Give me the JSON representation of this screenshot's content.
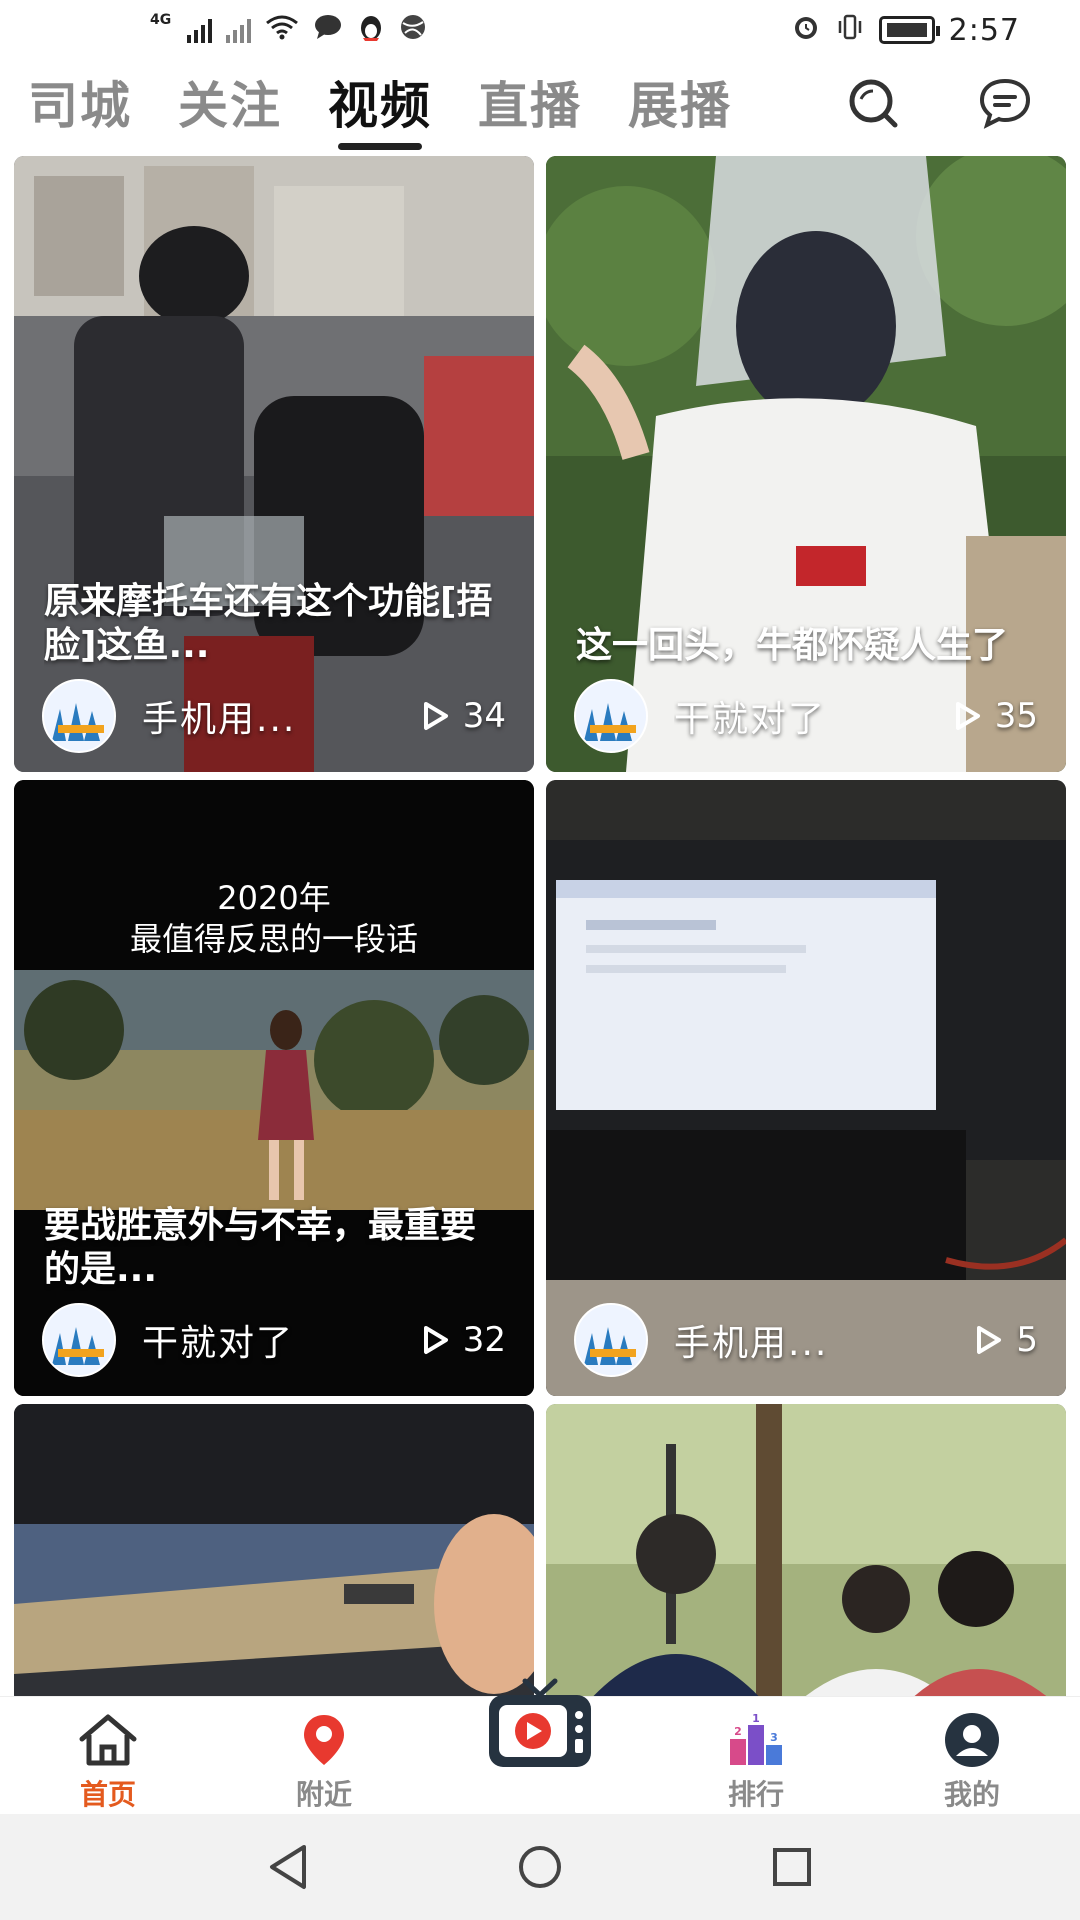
{
  "status_bar": {
    "network_label": "4G",
    "time": "2:57"
  },
  "top_nav": {
    "tabs": [
      {
        "label": "司城",
        "active": false
      },
      {
        "label": "关注",
        "active": false
      },
      {
        "label": "视频",
        "active": true
      },
      {
        "label": "直播",
        "active": false
      },
      {
        "label": "展播",
        "active": false
      }
    ],
    "icons": [
      "search-icon",
      "message-icon"
    ]
  },
  "feed": {
    "cards": [
      {
        "caption": "原来摩托车还有这个功能[捂脸]这鱼...",
        "author": "手机用...",
        "plays": "34"
      },
      {
        "caption": "这一回头，牛都怀疑人生了",
        "author": "干就对了",
        "plays": "35"
      },
      {
        "overlay": "2020年\n最值得反思的一段话",
        "caption": "要战胜意外与不幸，最重要的是...",
        "author": "干就对了",
        "plays": "32"
      },
      {
        "caption": "",
        "author": "手机用...",
        "plays": "5"
      },
      {
        "caption": "",
        "author": "",
        "plays": ""
      },
      {
        "caption": "",
        "author": "",
        "plays": ""
      }
    ]
  },
  "bottom_nav": {
    "items": [
      {
        "label": "首页",
        "icon": "home-icon",
        "active": true
      },
      {
        "label": "附近",
        "icon": "location-pin-icon",
        "active": false
      },
      {
        "label": "",
        "icon": "tv-play-icon",
        "active": false
      },
      {
        "label": "排行",
        "icon": "ranking-podium-icon",
        "active": false
      },
      {
        "label": "我的",
        "icon": "profile-icon",
        "active": false
      }
    ]
  },
  "colors": {
    "accent": "#e45a1e",
    "pin_red": "#e8392f",
    "inactive": "#8a8a8a"
  }
}
